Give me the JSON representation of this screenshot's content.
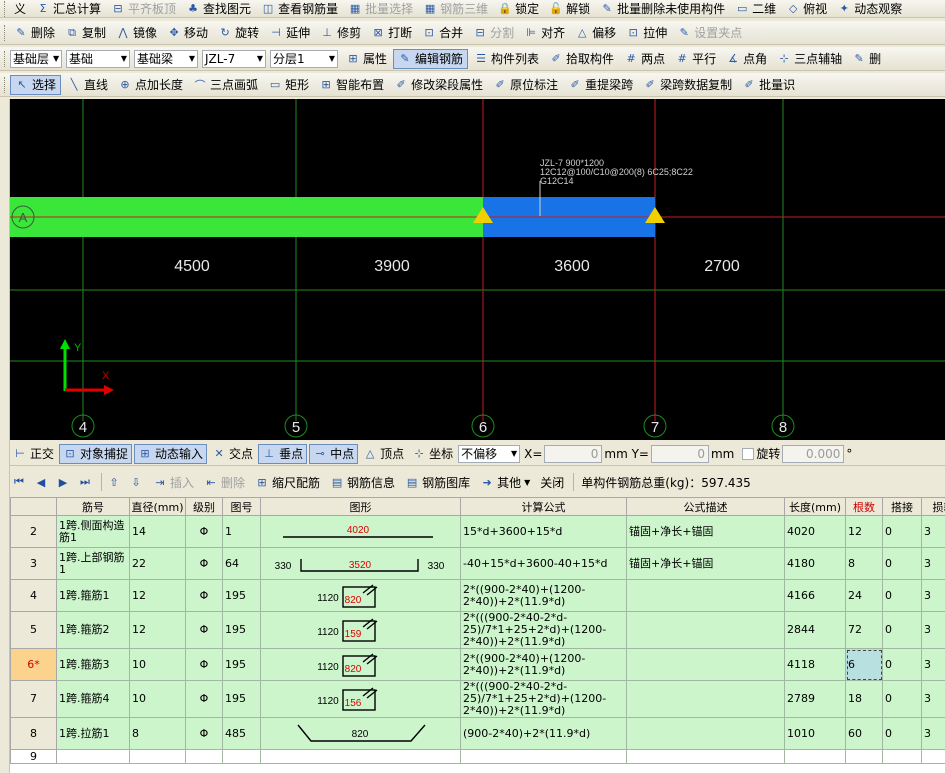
{
  "toolbar1": {
    "items": [
      {
        "label": "义",
        "icon": "",
        "disabled": false
      },
      {
        "label": "汇总计算",
        "icon": "Σ",
        "disabled": false
      },
      {
        "label": "平齐板顶",
        "icon": "⊟",
        "disabled": true
      },
      {
        "label": "查找图元",
        "icon": "♣",
        "disabled": false
      },
      {
        "label": "查看钢筋量",
        "icon": "◫",
        "disabled": false
      },
      {
        "label": "批量选择",
        "icon": "▦",
        "disabled": true
      },
      {
        "label": "钢筋三维",
        "icon": "▦",
        "disabled": true
      },
      {
        "label": "锁定",
        "icon": "🔒",
        "disabled": false
      },
      {
        "label": "解锁",
        "icon": "🔓",
        "disabled": false
      },
      {
        "label": "批量删除未使用构件",
        "icon": "✎",
        "disabled": false
      },
      {
        "label": "二维",
        "icon": "▭",
        "disabled": false
      },
      {
        "label": "俯视",
        "icon": "◇",
        "disabled": false
      },
      {
        "label": "动态观察",
        "icon": "✦",
        "disabled": false
      }
    ]
  },
  "toolbar2": {
    "items": [
      {
        "label": "删除",
        "icon": "✎"
      },
      {
        "label": "复制",
        "icon": "⧉"
      },
      {
        "label": "镜像",
        "icon": "⋀"
      },
      {
        "label": "移动",
        "icon": "✥"
      },
      {
        "label": "旋转",
        "icon": "↻"
      },
      {
        "label": "延伸",
        "icon": "⊣"
      },
      {
        "label": "修剪",
        "icon": "⊥"
      },
      {
        "label": "打断",
        "icon": "⊠"
      },
      {
        "label": "合并",
        "icon": "⊡"
      },
      {
        "label": "分割",
        "icon": "⊟",
        "disabled": true
      },
      {
        "label": "对齐",
        "icon": "⊫"
      },
      {
        "label": "偏移",
        "icon": "△"
      },
      {
        "label": "拉伸",
        "icon": "⊡"
      },
      {
        "label": "设置夹点",
        "icon": "✎",
        "disabled": true
      }
    ]
  },
  "toolbar3": {
    "combos": [
      "基础层",
      "基础",
      "基础梁",
      "JZL-7",
      "分层1"
    ],
    "items": [
      {
        "label": "属性",
        "icon": "⊞",
        "active": false
      },
      {
        "label": "编辑钢筋",
        "icon": "✎",
        "active": true
      },
      {
        "label": "构件列表",
        "icon": "☰",
        "active": false
      },
      {
        "label": "拾取构件",
        "icon": "✐",
        "active": false
      },
      {
        "label": "两点",
        "icon": "#",
        "active": false
      },
      {
        "label": "平行",
        "icon": "#",
        "active": false
      },
      {
        "label": "点角",
        "icon": "∡",
        "active": false
      },
      {
        "label": "三点辅轴",
        "icon": "⊹",
        "active": false
      },
      {
        "label": "删",
        "icon": "✎",
        "active": false
      }
    ]
  },
  "toolbar4": {
    "items": [
      {
        "label": "选择",
        "icon": "↖",
        "active": true
      },
      {
        "label": "直线",
        "icon": "╲",
        "active": false
      },
      {
        "label": "点加长度",
        "icon": "⊕",
        "active": false
      },
      {
        "label": "三点画弧",
        "icon": "⌒",
        "active": false
      },
      {
        "label": "矩形",
        "icon": "▭",
        "active": false
      },
      {
        "label": "智能布置",
        "icon": "⊞",
        "active": false
      },
      {
        "label": "修改梁段属性",
        "icon": "✐",
        "active": false
      },
      {
        "label": "原位标注",
        "icon": "✐",
        "active": false
      },
      {
        "label": "重提梁跨",
        "icon": "✐",
        "active": false
      },
      {
        "label": "梁跨数据复制",
        "icon": "✐",
        "active": false
      },
      {
        "label": "批量识",
        "icon": "✐",
        "active": false
      }
    ]
  },
  "canvas": {
    "axis_label_row": "A",
    "column_labels": [
      "4",
      "5",
      "6",
      "7",
      "8"
    ],
    "dimensions": [
      "4500",
      "3900",
      "3600",
      "2700"
    ],
    "beam_note": {
      "line1": "JZL-7 900*1200",
      "line2": "12C12@100/C10@200(8) 6C25;8C22",
      "line3": "G12C14"
    },
    "ucs": {
      "x_label": "X",
      "y_label": "Y"
    },
    "colors": {
      "background": "#000000",
      "grid_green": "#1e8c1e",
      "grid_red": "#c81e1e",
      "beam_green": "#39e639",
      "beam_blue": "#1874e6",
      "support_yellow": "#f0d000"
    }
  },
  "statusbar": {
    "items": [
      {
        "label": "正交",
        "icon": "⊢",
        "pressed": false
      },
      {
        "label": "对象捕捉",
        "icon": "⊡",
        "pressed": true
      },
      {
        "label": "动态输入",
        "icon": "⊞",
        "pressed": true
      },
      {
        "label": "交点",
        "icon": "✕",
        "pressed": false
      },
      {
        "label": "垂点",
        "icon": "⊥",
        "pressed": true
      },
      {
        "label": "中点",
        "icon": "⊸",
        "pressed": true
      },
      {
        "label": "顶点",
        "icon": "△",
        "pressed": false
      },
      {
        "label": "坐标",
        "icon": "⊹",
        "pressed": false
      }
    ],
    "offset_combo": "不偏移",
    "x_label": "X=",
    "x_value": "0",
    "y_label": "mm Y=",
    "y_value": "0",
    "mm": "mm",
    "rotate_label": "旋转",
    "rotate_value": "0.000",
    "degree": "°"
  },
  "table_toolbar": {
    "insert": "插入",
    "delete": "删除",
    "scale_rebar": "缩尺配筋",
    "rebar_info": "钢筋信息",
    "rebar_library": "钢筋图库",
    "other": "其他",
    "close": "关闭",
    "total_weight_label": "单构件钢筋总重(kg)：597.435"
  },
  "table": {
    "headers": [
      "筋号",
      "直径(mm)",
      "级别",
      "图号",
      "图形",
      "计算公式",
      "公式描述",
      "长度(mm)",
      "根数",
      "搭接",
      "损耗"
    ],
    "rows": [
      {
        "num": "2",
        "name": "1跨.侧面构造筋1",
        "dia": "14",
        "grade": "Φ",
        "fig": "1",
        "shape": {
          "type": "line",
          "a": "4020"
        },
        "formula": "15*d+3600+15*d",
        "desc": "锚固+净长+锚固",
        "length": "4020",
        "count": "12",
        "lap": "0",
        "loss": "3"
      },
      {
        "num": "3",
        "name": "1跨.上部钢筋1",
        "dia": "22",
        "grade": "Φ",
        "fig": "64",
        "shape": {
          "type": "u",
          "left": "330",
          "a": "3520",
          "right": "330"
        },
        "formula": "-40+15*d+3600-40+15*d",
        "desc": "锚固+净长+锚固",
        "length": "4180",
        "count": "8",
        "lap": "0",
        "loss": "3"
      },
      {
        "num": "4",
        "name": "1跨.箍筋1",
        "dia": "12",
        "grade": "Φ",
        "fig": "195",
        "shape": {
          "type": "stirrup",
          "h": "1120",
          "w": "820"
        },
        "formula": "2*((900-2*40)+(1200-2*40))+2*(11.9*d)",
        "desc": "",
        "length": "4166",
        "count": "24",
        "lap": "0",
        "loss": "3"
      },
      {
        "num": "5",
        "name": "1跨.箍筋2",
        "dia": "12",
        "grade": "Φ",
        "fig": "195",
        "shape": {
          "type": "stirrup",
          "h": "1120",
          "w": "159"
        },
        "formula": "2*(((900-2*40-2*d-25)/7*1+25+2*d)+(1200-2*40))+2*(11.9*d)",
        "desc": "",
        "length": "2844",
        "count": "72",
        "lap": "0",
        "loss": "3"
      },
      {
        "num": "6*",
        "name": "1跨.箍筋3",
        "dia": "10",
        "grade": "Φ",
        "fig": "195",
        "shape": {
          "type": "stirrup",
          "h": "1120",
          "w": "820"
        },
        "formula": "2*((900-2*40)+(1200-2*40))+2*(11.9*d)",
        "desc": "",
        "length": "4118",
        "count": "6",
        "lap": "0",
        "loss": "3",
        "selected": true
      },
      {
        "num": "7",
        "name": "1跨.箍筋4",
        "dia": "10",
        "grade": "Φ",
        "fig": "195",
        "shape": {
          "type": "stirrup",
          "h": "1120",
          "w": "156"
        },
        "formula": "2*(((900-2*40-2*d-25)/7*1+25+2*d)+(1200-2*40))+2*(11.9*d)",
        "desc": "",
        "length": "2789",
        "count": "18",
        "lap": "0",
        "loss": "3"
      },
      {
        "num": "8",
        "name": "1跨.拉筋1",
        "dia": "8",
        "grade": "Φ",
        "fig": "485",
        "shape": {
          "type": "tie",
          "a": "820"
        },
        "formula": "(900-2*40)+2*(11.9*d)",
        "desc": "",
        "length": "1010",
        "count": "60",
        "lap": "0",
        "loss": "3"
      },
      {
        "num": "9",
        "name": "",
        "dia": "",
        "grade": "",
        "fig": "",
        "shape": {
          "type": "none"
        },
        "formula": "",
        "desc": "",
        "length": "",
        "count": "",
        "lap": "",
        "loss": "",
        "empty": true
      }
    ]
  }
}
